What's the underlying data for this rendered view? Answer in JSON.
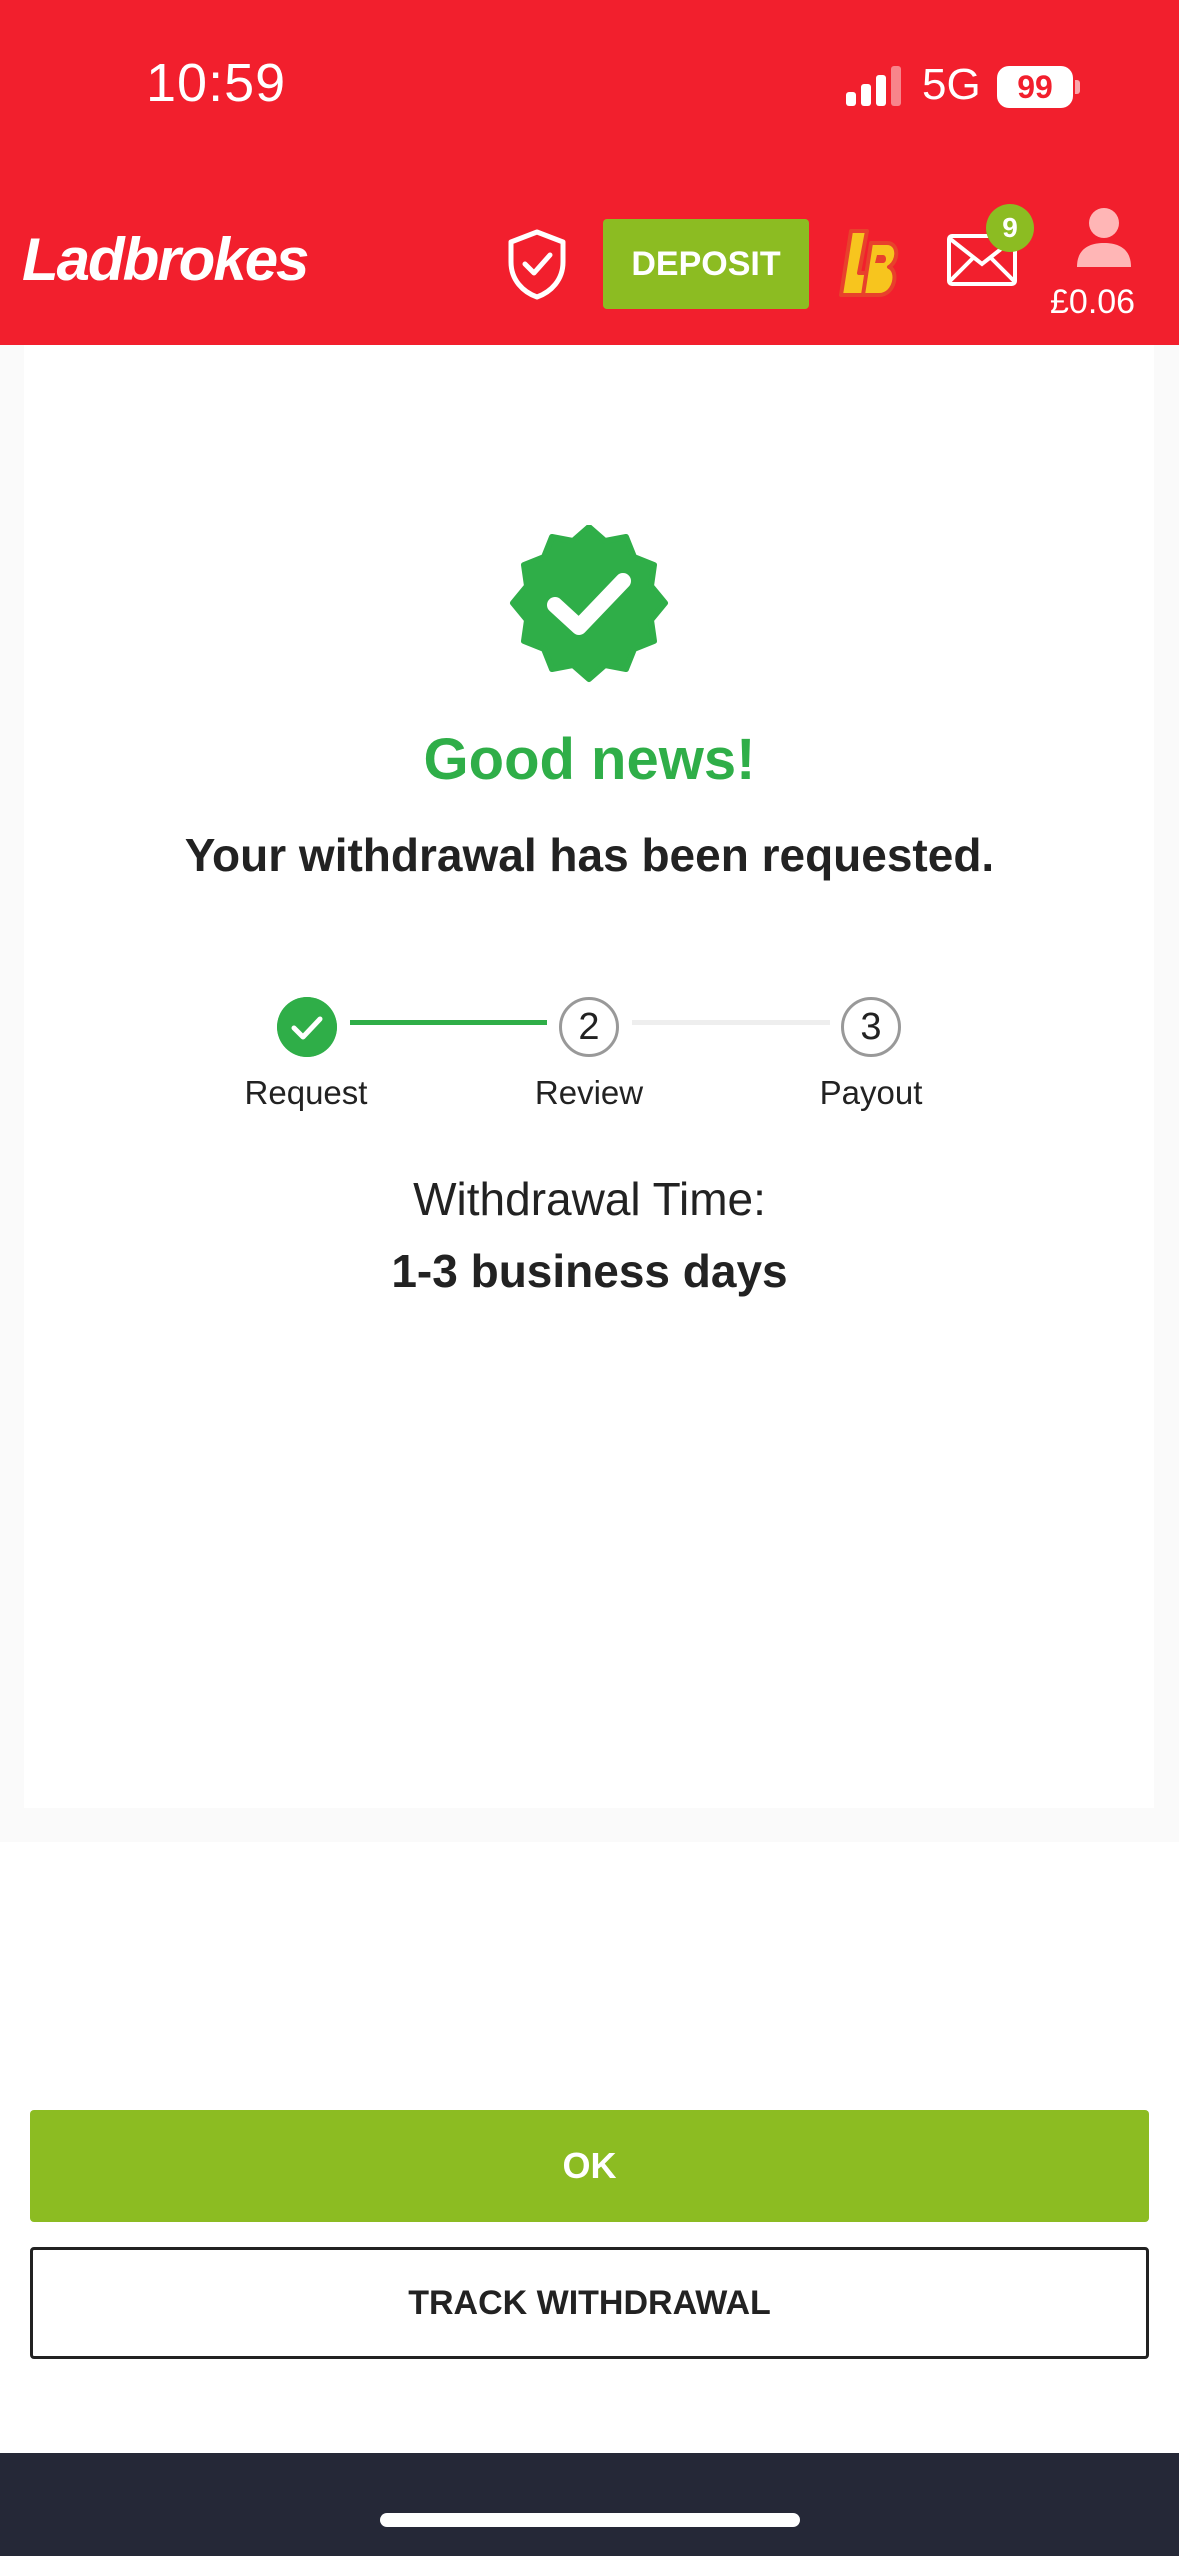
{
  "status_bar": {
    "time": "10:59",
    "network": "5G",
    "battery": "99"
  },
  "header": {
    "logo": "Ladbrokes",
    "deposit_label": "DEPOSIT",
    "mail_badge": "9",
    "balance": "£0.06",
    "brand_color": "#f21f2d",
    "accent_color": "#8cbc22"
  },
  "confirmation": {
    "headline": "Good news!",
    "message": "Your withdrawal has been requested.",
    "success_color": "#2fae48"
  },
  "stepper": {
    "steps": [
      {
        "number": "",
        "label": "Request",
        "state": "done"
      },
      {
        "number": "2",
        "label": "Review",
        "state": "pending"
      },
      {
        "number": "3",
        "label": "Payout",
        "state": "pending"
      }
    ]
  },
  "withdrawal_time": {
    "label": "Withdrawal Time:",
    "value": "1-3 business days"
  },
  "actions": {
    "ok_label": "OK",
    "track_label": "TRACK WITHDRAWAL"
  }
}
